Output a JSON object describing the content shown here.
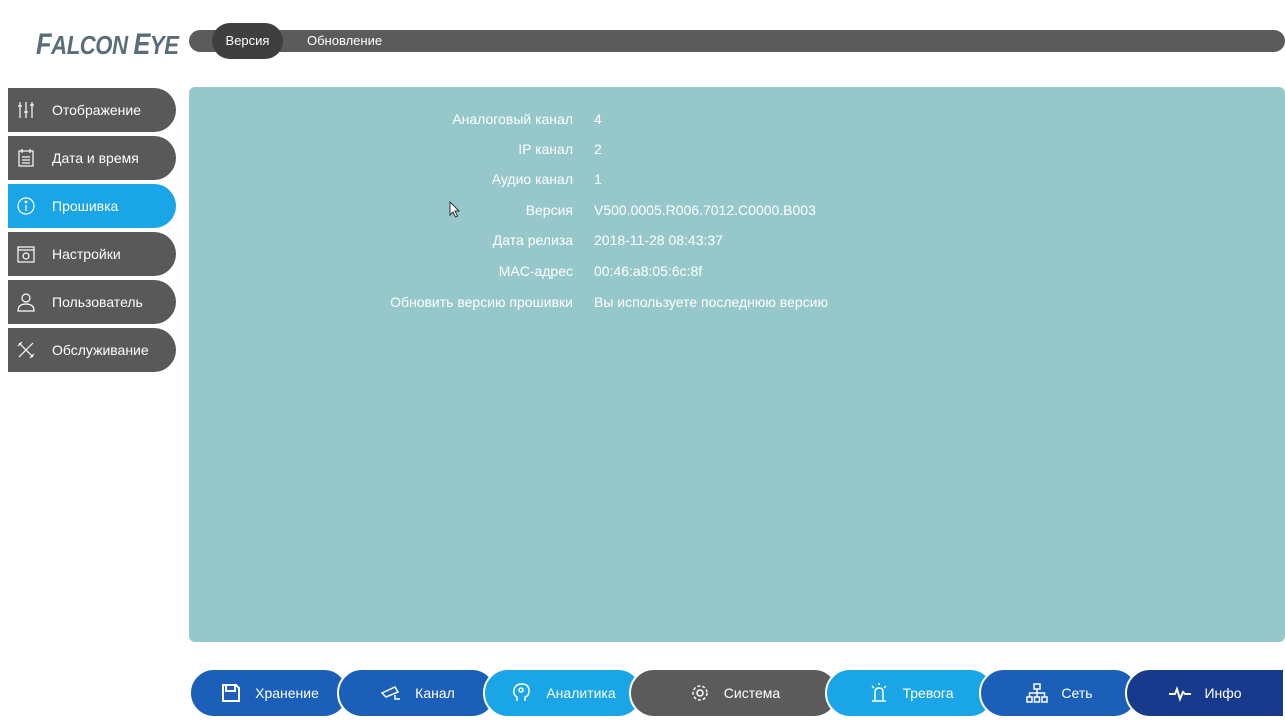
{
  "logo": {
    "first": "F",
    "rest1": "ALCON ",
    "second": "E",
    "rest2": "YE"
  },
  "tabs": [
    {
      "label": "Версия"
    },
    {
      "label": "Обновление"
    }
  ],
  "sidebar": {
    "items": [
      {
        "label": "Отображение",
        "icon": "sliders-icon"
      },
      {
        "label": "Дата и время",
        "icon": "calendar-icon"
      },
      {
        "label": "Прошивка",
        "icon": "info-icon",
        "active": true
      },
      {
        "label": "Настройки",
        "icon": "settings-folder-icon"
      },
      {
        "label": "Пользователь",
        "icon": "user-icon"
      },
      {
        "label": "Обслуживание",
        "icon": "tools-icon"
      }
    ]
  },
  "info": {
    "rows": [
      {
        "label": "Аналоговый канал",
        "value": "4"
      },
      {
        "label": "IP канал",
        "value": "2"
      },
      {
        "label": "Аудио канал",
        "value": "1"
      },
      {
        "label": "Версия",
        "value": "V500.0005.R006.7012.C0000.B003"
      },
      {
        "label": "Дата релиза",
        "value": "2018-11-28 08:43:37"
      },
      {
        "label": "MAC-адрес",
        "value": "00:46:a8:05:6c:8f"
      },
      {
        "label": "Обновить версию прошивки",
        "value": "Вы используете последнюю версию"
      }
    ]
  },
  "bottom_nav": [
    {
      "label": "Хранение",
      "icon": "storage-icon"
    },
    {
      "label": "Канал",
      "icon": "camera-icon"
    },
    {
      "label": "Аналитика",
      "icon": "analytics-icon"
    },
    {
      "label": "Система",
      "icon": "gear-icon",
      "active": true
    },
    {
      "label": "Тревога",
      "icon": "alarm-icon"
    },
    {
      "label": "Сеть",
      "icon": "network-icon"
    },
    {
      "label": "Инфо",
      "icon": "pulse-icon"
    }
  ],
  "colors": {
    "accent": "#1aa5e6",
    "panel": "#96c8cb",
    "dark": "#595959",
    "nav_blue": "#1b5fb8",
    "nav_light": "#1aa5e6",
    "nav_navy": "#173a8c"
  }
}
